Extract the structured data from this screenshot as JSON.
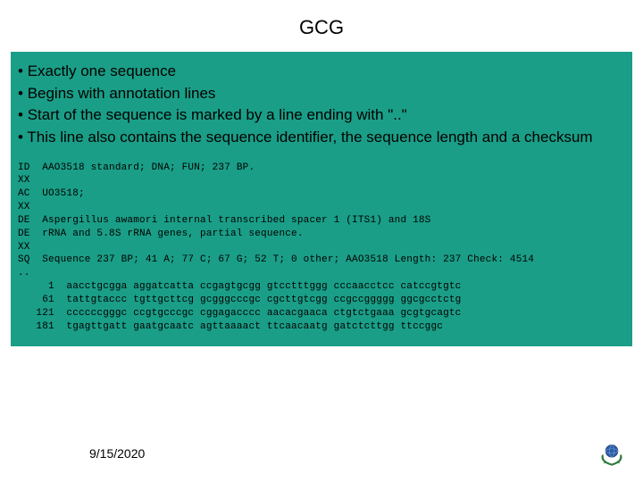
{
  "title": "GCG",
  "bullets": [
    "Exactly one sequence",
    "Begins with annotation lines",
    "Start of the sequence is marked by a line ending with \"..\"",
    "This line also contains the sequence identifier, the sequence length and a checksum"
  ],
  "seq": {
    "l1": "ID  AAO3518 standard; DNA; FUN; 237 BP.",
    "l2": "XX",
    "l3": "AC  UO3518;",
    "l4": "XX",
    "l5": "DE  Aspergillus awamori internal transcribed spacer 1 (ITS1) and 18S",
    "l6": "DE  rRNA and 5.8S rRNA genes, partial sequence.",
    "l7": "XX",
    "l8": "SQ  Sequence 237 BP; 41 A; 77 C; 67 G; 52 T; 0 other; AAO3518 Length: 237 Check: 4514",
    "l9": "..",
    "l10": "     1  aacctgcgga aggatcatta ccgagtgcgg gtcctttggg cccaacctcc catccgtgtc",
    "l11": "    61  tattgtaccc tgttgcttcg gcgggcccgc cgcttgtcgg ccgccggggg ggcgcctctg",
    "l12": "   121  ccccccgggc ccgtgcccgc cggagacccc aacacgaaca ctgtctgaaa gcgtgcagtc",
    "l13": "   181  tgagttgatt gaatgcaatc agttaaaact ttcaacaatg gatctcttgg ttccggc"
  },
  "footer_date": "9/15/2020"
}
